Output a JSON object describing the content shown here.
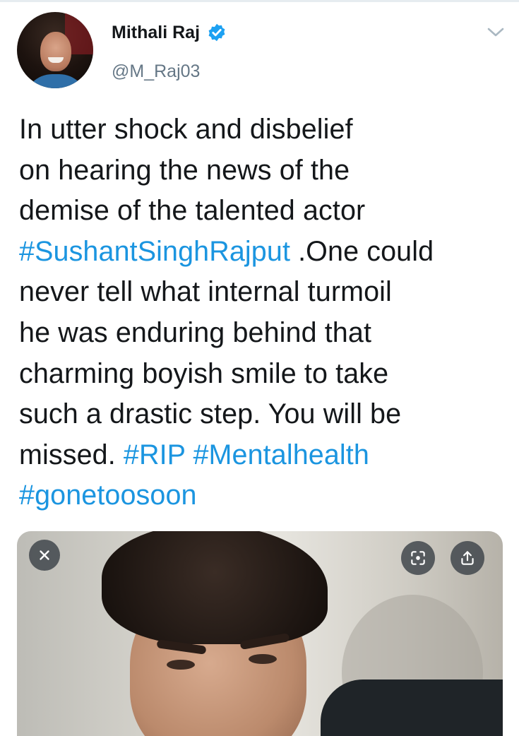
{
  "author": {
    "name": "Mithali Raj",
    "handle": "@M_Raj03",
    "verified": true,
    "verified_icon": "verified-badge-icon",
    "verified_color": "#1da1f2"
  },
  "tweet": {
    "lines": [
      [
        {
          "text": "In utter shock and disbelief",
          "tag": false
        }
      ],
      [
        {
          "text": "on hearing the news of the",
          "tag": false
        }
      ],
      [
        {
          "text": "demise of the talented actor",
          "tag": false
        }
      ],
      [
        {
          "text": "#SushantSinghRajput",
          "tag": true
        },
        {
          "text": " .One could",
          "tag": false
        }
      ],
      [
        {
          "text": "never tell what internal turmoil",
          "tag": false
        }
      ],
      [
        {
          "text": "he was enduring behind that",
          "tag": false
        }
      ],
      [
        {
          "text": "charming boyish smile to take",
          "tag": false
        }
      ],
      [
        {
          "text": "such a drastic step. You will be",
          "tag": false
        }
      ],
      [
        {
          "text": "missed. ",
          "tag": false
        },
        {
          "text": "#RIP",
          "tag": true
        },
        {
          "text": " ",
          "tag": false
        },
        {
          "text": "#Mentalhealth",
          "tag": true
        }
      ],
      [
        {
          "text": "#gonetoosoon",
          "tag": true
        }
      ]
    ],
    "hashtag_color": "#1b95e0",
    "text_color": "#14171a"
  },
  "media": {
    "close_icon": "close-icon",
    "scan_icon": "scan-icon",
    "share_icon": "share-icon"
  },
  "menu": {
    "icon": "chevron-down-icon"
  }
}
